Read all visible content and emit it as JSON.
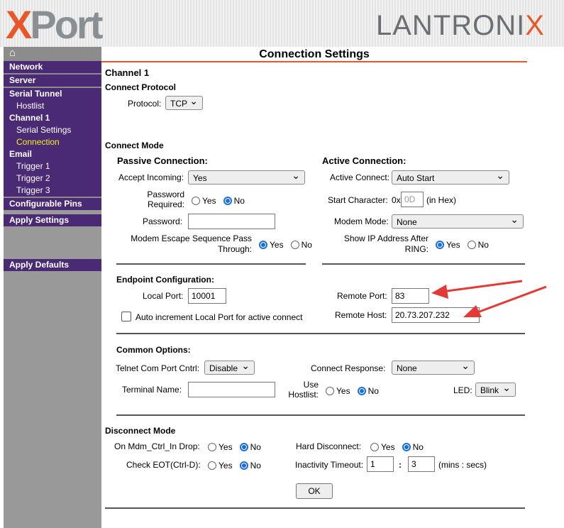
{
  "header": {
    "logo_left": "XPort",
    "logo_right": "LANTRONIX"
  },
  "sidebar": {
    "items": [
      {
        "label": "Network",
        "type": "main"
      },
      {
        "label": "Server",
        "type": "main"
      },
      {
        "label": "Serial Tunnel",
        "type": "main"
      },
      {
        "label": "Hostlist",
        "type": "sub"
      },
      {
        "label": "Channel 1",
        "type": "main"
      },
      {
        "label": "Serial Settings",
        "type": "sub"
      },
      {
        "label": "Connection",
        "type": "sub"
      },
      {
        "label": "Email",
        "type": "main"
      },
      {
        "label": "Trigger 1",
        "type": "sub"
      },
      {
        "label": "Trigger 2",
        "type": "sub"
      },
      {
        "label": "Trigger 3",
        "type": "sub"
      },
      {
        "label": "Configurable Pins",
        "type": "main"
      }
    ],
    "apply_settings": "Apply Settings",
    "apply_defaults": "Apply Defaults"
  },
  "page": {
    "title": "Connection Settings",
    "channel": "Channel 1"
  },
  "protocol": {
    "section": "Connect Protocol",
    "label": "Protocol:",
    "value": "TCP"
  },
  "mode": {
    "section": "Connect Mode",
    "passive": {
      "heading": "Passive Connection:",
      "accept_label": "Accept Incoming:",
      "accept_value": "Yes",
      "pw_req_label1": "Password",
      "pw_req_label2": "Required:",
      "password_label": "Password:",
      "password_value": "",
      "esc_label1": "Modem Escape Sequence Pass",
      "esc_label2": "Through:"
    },
    "active": {
      "heading": "Active Connection:",
      "connect_label": "Active Connect:",
      "connect_value": "Auto Start",
      "start_label": "Start Character:",
      "start_prefix": "0x",
      "start_placeholder": "0D",
      "start_suffix": "(in Hex)",
      "modem_label": "Modem Mode:",
      "modem_value": "None",
      "showip_label1": "Show IP Address After",
      "showip_label2": "RING:"
    },
    "yes": "Yes",
    "no": "No"
  },
  "endpoint": {
    "heading": "Endpoint Configuration:",
    "local_port_label": "Local Port:",
    "local_port": "10001",
    "auto_inc": "Auto increment Local Port for active connect",
    "remote_port_label": "Remote Port:",
    "remote_port": "83",
    "remote_host_label": "Remote Host:",
    "remote_host": "20.73.207.232"
  },
  "common": {
    "heading": "Common Options:",
    "telnet_label": "Telnet Com Port Cntrl:",
    "telnet_value": "Disable",
    "response_label": "Connect Response:",
    "response_value": "None",
    "terminal_label": "Terminal Name:",
    "terminal_value": "",
    "hostlist_label1": "Use",
    "hostlist_label2": "Hostlist:",
    "led_label": "LED:",
    "led_value": "Blink"
  },
  "disconnect": {
    "section": "Disconnect Mode",
    "mdm_label": "On Mdm_Ctrl_In Drop:",
    "hard_label": "Hard Disconnect:",
    "eot_label": "Check EOT(Ctrl-D):",
    "inact_label": "Inactivity Timeout:",
    "inact_min": "1",
    "inact_sep": ":",
    "inact_sec": "3",
    "inact_units": "(mins : secs)",
    "ok": "OK"
  },
  "colors": {
    "purple": "#4a2a75",
    "orange": "#e8572a",
    "annotation": "#e53935"
  }
}
